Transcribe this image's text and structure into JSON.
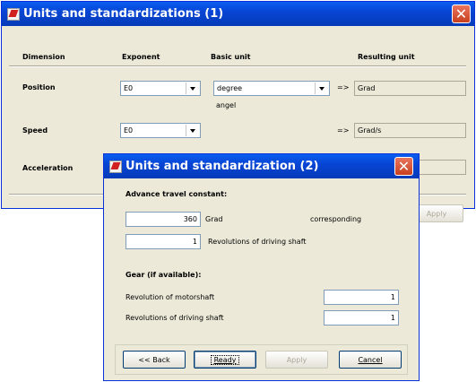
{
  "window1": {
    "title": "Units and standardizations (1)",
    "close_glyph": "✕",
    "headers": {
      "dimension": "Dimension",
      "exponent": "Exponent",
      "basic_unit": "Basic unit",
      "resulting_unit": "Resulting unit"
    },
    "rows": [
      {
        "label": "Position",
        "exponent": "E0",
        "basic_unit": "degree",
        "note": "angel",
        "arrow": "=>",
        "result": "Grad"
      },
      {
        "label": "Speed",
        "exponent": "E0",
        "arrow": "=>",
        "result": "Grad/s"
      },
      {
        "label": "Acceleration"
      }
    ],
    "apply_label": "Apply"
  },
  "window2": {
    "title": "Units and standardization (2)",
    "close_glyph": "✕",
    "travel_heading": "Advance travel constant:",
    "travel_value": "360",
    "travel_unit": "Grad",
    "corresponding": "corresponding",
    "revolutions_value": "1",
    "revolutions_label": "Revolutions of driving shaft",
    "gear_heading": "Gear (if available):",
    "motorshaft_label": "Revolution of motorshaft",
    "motorshaft_value": "1",
    "driving_shaft_label": "Revolutions of driving shaft",
    "driving_shaft_value": "1",
    "buttons": {
      "back": "<< Back",
      "ready": "Ready",
      "apply": "Apply",
      "cancel": "Cancel"
    }
  },
  "colors": {
    "title_bar": "#0845d4",
    "window_face": "#ece9d8",
    "close_button": "#d0502e"
  }
}
